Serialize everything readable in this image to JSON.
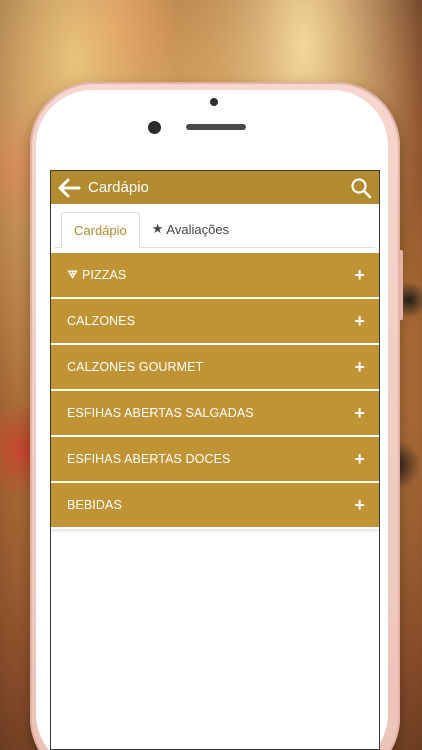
{
  "appbar": {
    "title": "Cardápio",
    "back_icon": "arrow-left-icon",
    "search_icon": "search-icon"
  },
  "tabs": [
    {
      "label": "Cardápio",
      "active": true
    },
    {
      "label": "Avaliações",
      "active": false,
      "icon": "star-icon"
    }
  ],
  "menu": {
    "items": [
      {
        "label": "PIZZAS",
        "icon": "pizza-slice-icon"
      },
      {
        "label": "CALZONES"
      },
      {
        "label": "CALZONES GOURMET"
      },
      {
        "label": "ESFIHAS ABERTAS SALGADAS"
      },
      {
        "label": "ESFIHAS ABERTAS DOCES"
      },
      {
        "label": "BEBIDAS"
      }
    ],
    "expand_symbol": "+"
  },
  "colors": {
    "appbar": "#b28b2f",
    "menu_item": "#c09435",
    "active_tab_text": "#b28b2f"
  }
}
